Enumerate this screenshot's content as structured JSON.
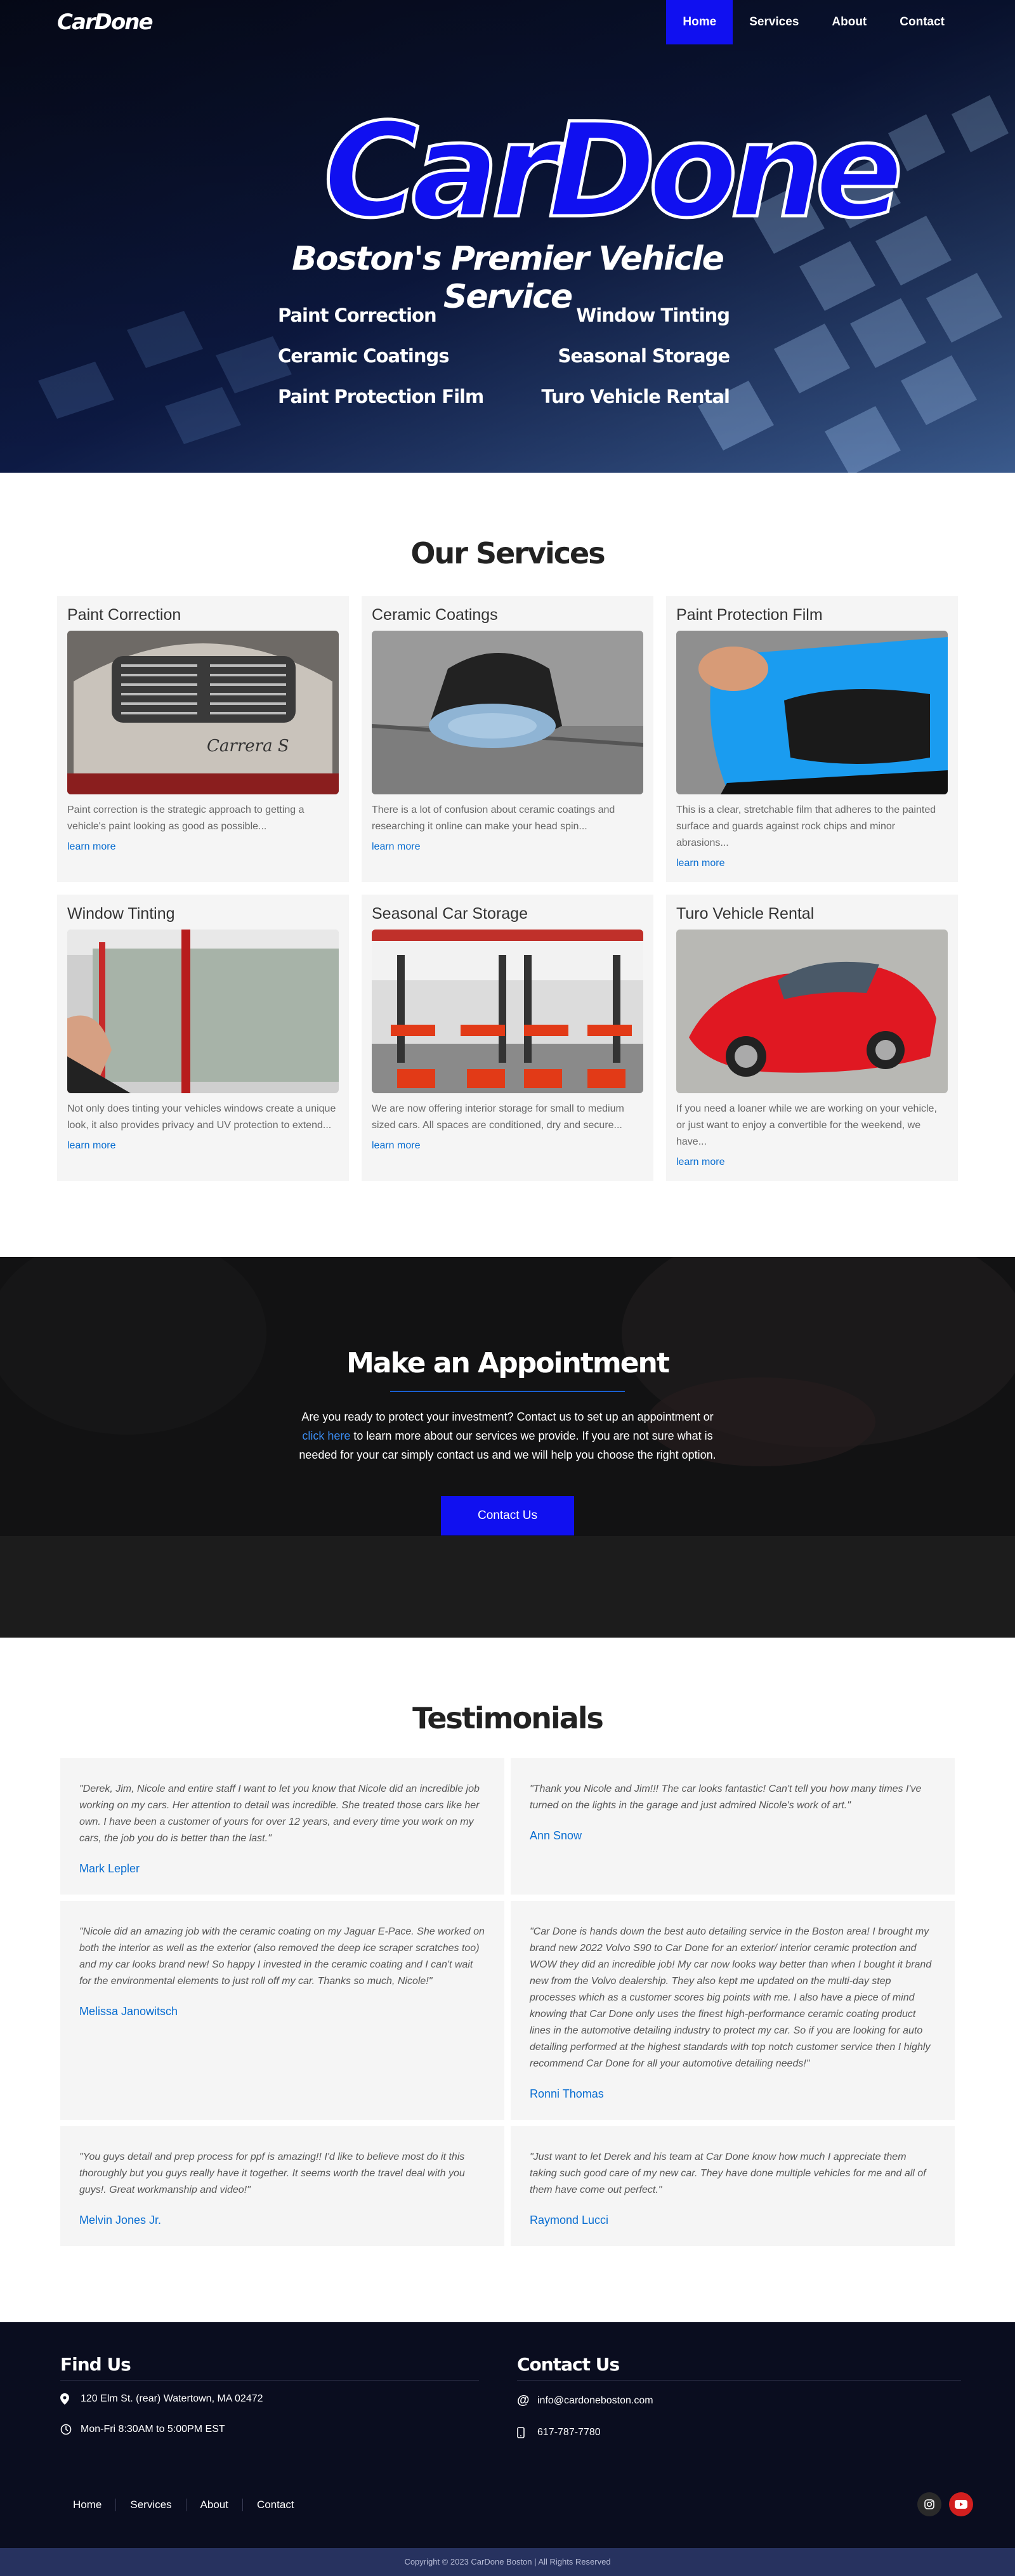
{
  "brand": {
    "logo_small": "CarDone",
    "logo_large": "CarDone"
  },
  "nav": {
    "items": [
      {
        "label": "Home"
      },
      {
        "label": "Services"
      },
      {
        "label": "About"
      },
      {
        "label": "Contact"
      }
    ]
  },
  "hero": {
    "tagline": "Boston's Premier Vehicle Service",
    "services_left": [
      "Paint Correction",
      "Ceramic Coatings",
      "Paint Protection Film"
    ],
    "services_right": [
      "Window Tinting",
      "Seasonal Storage",
      "Turo Vehicle Rental"
    ]
  },
  "services": {
    "title": "Our Services",
    "cards": [
      {
        "title": "Paint Correction",
        "desc": "Paint correction is the strategic approach to getting a vehicle's paint looking as good as possible...",
        "link": "learn more"
      },
      {
        "title": "Ceramic Coatings",
        "desc": "There is a lot of confusion about ceramic coatings and researching it online can make your head spin...",
        "link": "learn more"
      },
      {
        "title": "Paint Protection Film",
        "desc": "This is a clear, stretchable film that adheres to the painted surface and guards against rock chips and minor abrasions...",
        "link": "learn more"
      },
      {
        "title": "Window Tinting",
        "desc": "Not only does tinting your vehicles windows create a unique look, it also provides privacy and UV protection to extend...",
        "link": "learn more"
      },
      {
        "title": "Seasonal Car Storage",
        "desc": "We are now offering interior storage for small to medium sized cars. All spaces are conditioned, dry and secure...",
        "link": "learn more"
      },
      {
        "title": "Turo Vehicle Rental",
        "desc": "If you need a loaner while we are working on your vehicle, or just want to enjoy a convertible for the weekend, we have...",
        "link": "learn more"
      }
    ]
  },
  "appointment": {
    "title": "Make an Appointment",
    "text_before": "Are you ready to protect your investment? Contact us to set up an appointment or ",
    "link": "click here",
    "text_after": " to learn more about our services we provide. If you are not sure what is needed for your car simply contact us and we will help you choose the right option.",
    "button": "Contact Us"
  },
  "testimonials": {
    "title": "Testimonials",
    "items": [
      {
        "quote": "\"Derek, Jim, Nicole and entire staff I want to let you know that Nicole did an incredible job working on my cars. Her attention to detail was incredible. She treated those cars like her own. I have been a customer of yours for over 12 years, and every time you work on my cars, the job you do is better than the last.\"",
        "name": "Mark Lepler"
      },
      {
        "quote": "\"Thank you Nicole and Jim!!!  The car looks fantastic! Can't tell you how many times I've turned on the lights in the garage and just admired Nicole's work of art.\"",
        "name": "Ann Snow"
      },
      {
        "quote": "\"Nicole did an amazing job with the ceramic coating on my Jaguar E-Pace. She worked on both the interior as well as the exterior (also removed the deep ice scraper scratches too) and my car looks brand new! So happy I invested in the ceramic coating and I can't wait for the environmental elements to just roll off my car. Thanks so much, Nicole!\"",
        "name": "Melissa Janowitsch"
      },
      {
        "quote": "\"Car Done is hands down the best auto detailing service in the Boston area! I brought my brand new 2022 Volvo S90 to Car Done for an exterior/ interior ceramic protection and WOW they did an incredible job! My car now looks way better than when I bought it brand new from the Volvo dealership. They also kept me updated on the multi-day step processes which as a customer scores big points with me. I also have a piece of mind knowing that Car Done only uses the finest high-performance ceramic coating product lines in the automotive detailing industry to protect my car. So if you are looking for auto detailing performed at the highest standards with top notch customer service then I highly recommend Car Done for all your automotive detailing needs!\"",
        "name": "Ronni Thomas"
      },
      {
        "quote": "\"You guys detail and prep process for ppf is amazing!! I'd like to believe most do it this thoroughly but you guys really have it together. It seems worth the travel deal with you guys!. Great workmanship and video!\"",
        "name": "Melvin Jones Jr."
      },
      {
        "quote": "\"Just want to let Derek and his team at Car Done know how much I appreciate them taking such good care of my new car. They have done multiple vehicles for me and all of them have come out perfect.\"",
        "name": "Raymond Lucci"
      }
    ]
  },
  "footer": {
    "find_us": {
      "title": "Find Us",
      "address": "120 Elm St. (rear) Watertown, MA 02472",
      "hours": "Mon-Fri 8:30AM to 5:00PM EST"
    },
    "contact": {
      "title": "Contact Us",
      "email": "info@cardoneboston.com",
      "phone": "617-787-7780"
    },
    "nav": [
      "Home",
      "Services",
      "About",
      "Contact"
    ],
    "copyright": "Copyright © 2023 CarDone Boston | All Rights Reserved"
  },
  "colors": {
    "brand_blue": "#1010f0",
    "link_blue": "#0a6ed1",
    "footer_bg": "#0a0d1f",
    "copyright_bg": "#27325f"
  },
  "icons": [
    "map-pin-icon",
    "clock-icon",
    "at-icon",
    "phone-icon",
    "instagram-icon",
    "youtube-icon"
  ]
}
